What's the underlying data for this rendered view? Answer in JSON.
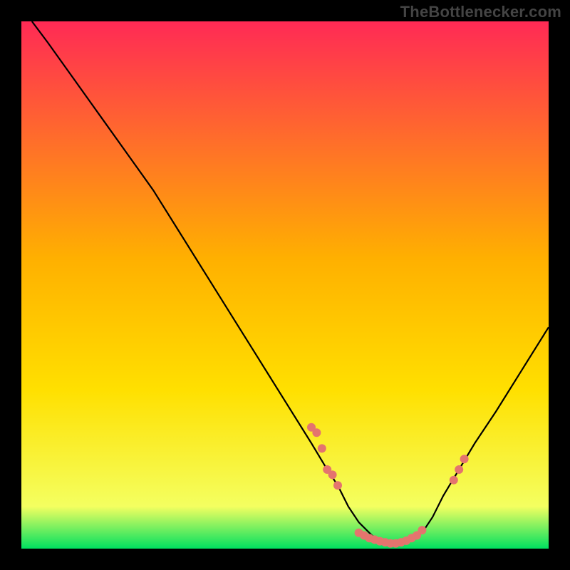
{
  "attribution": "TheBottlenecker.com",
  "chart_data": {
    "type": "line",
    "title": "",
    "xlabel": "",
    "ylabel": "",
    "xlim": [
      0,
      100
    ],
    "ylim": [
      0,
      100
    ],
    "background_gradient": {
      "top": "#ff2a55",
      "mid": "#ffd400",
      "bottom": "#00e060"
    },
    "curve": {
      "name": "bottleneck-curve",
      "color": "#000000",
      "x": [
        2,
        5,
        10,
        15,
        20,
        25,
        30,
        35,
        40,
        45,
        50,
        55,
        58,
        60,
        62,
        64,
        67,
        70,
        73,
        76,
        78,
        80,
        83,
        86,
        90,
        95,
        100
      ],
      "y": [
        100,
        96,
        89,
        82,
        75,
        68,
        60,
        52,
        44,
        36,
        28,
        20,
        15,
        12,
        8,
        5,
        2,
        1,
        1,
        3,
        6,
        10,
        15,
        20,
        26,
        34,
        42
      ]
    },
    "markers": {
      "name": "highlight-points",
      "color": "#e4746e",
      "radius": 6,
      "points": [
        {
          "x": 55,
          "y": 23
        },
        {
          "x": 56,
          "y": 22
        },
        {
          "x": 57,
          "y": 19
        },
        {
          "x": 58,
          "y": 15
        },
        {
          "x": 59,
          "y": 14
        },
        {
          "x": 60,
          "y": 12
        },
        {
          "x": 64,
          "y": 3
        },
        {
          "x": 65,
          "y": 2.5
        },
        {
          "x": 66,
          "y": 2
        },
        {
          "x": 67,
          "y": 1.7
        },
        {
          "x": 68,
          "y": 1.4
        },
        {
          "x": 69,
          "y": 1.2
        },
        {
          "x": 70,
          "y": 1
        },
        {
          "x": 71,
          "y": 1
        },
        {
          "x": 72,
          "y": 1.2
        },
        {
          "x": 73,
          "y": 1.5
        },
        {
          "x": 74,
          "y": 2
        },
        {
          "x": 75,
          "y": 2.5
        },
        {
          "x": 76,
          "y": 3.5
        },
        {
          "x": 82,
          "y": 13
        },
        {
          "x": 83,
          "y": 15
        },
        {
          "x": 84,
          "y": 17
        }
      ]
    }
  }
}
